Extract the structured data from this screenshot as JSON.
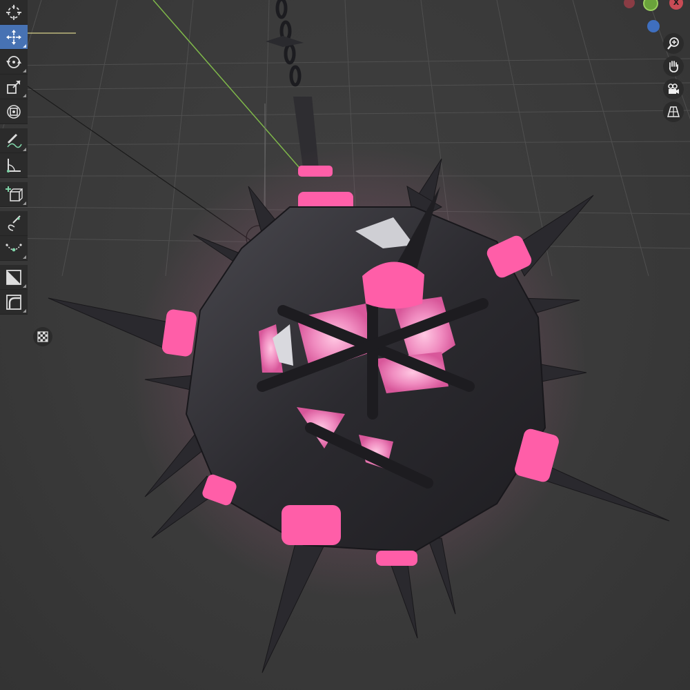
{
  "app": "3D viewport",
  "colors": {
    "viewport_bg": "#3a3a3a",
    "grid": "#555555",
    "toolbar_bg": "#2b2b2b",
    "active_tool": "#4772b3",
    "glow_pink": "#ff5ea8",
    "metal": "#2e2d31",
    "axis_y": "#7fb84a",
    "axis_x_gizmo": "#c84b55",
    "axis_z_gizmo": "#3f6fbf"
  },
  "toolbar": {
    "tools": [
      {
        "id": "cursor",
        "icon": "cursor-icon",
        "active": false
      },
      {
        "id": "move",
        "icon": "move-icon",
        "active": true
      },
      {
        "id": "rotate",
        "icon": "rotate-icon",
        "active": false
      },
      {
        "id": "scale",
        "icon": "scale-icon",
        "active": false
      },
      {
        "id": "transform",
        "icon": "transform-icon",
        "active": false
      },
      {
        "id": "annotate",
        "icon": "annotate-icon",
        "active": false
      },
      {
        "id": "measure",
        "icon": "measure-icon",
        "active": false
      },
      {
        "id": "add-cube",
        "icon": "add-cube-icon",
        "active": false
      },
      {
        "id": "curve-draw",
        "icon": "curve-draw-icon",
        "active": false
      },
      {
        "id": "curve-pen",
        "icon": "curve-pen-icon",
        "active": false
      },
      {
        "id": "extrude",
        "icon": "extrude-icon",
        "active": false
      },
      {
        "id": "bevel",
        "icon": "bevel-icon",
        "active": false
      }
    ]
  },
  "navigation": {
    "buttons": [
      "zoom-icon",
      "hand-pan-icon",
      "camera-icon",
      "perspective-grid-icon"
    ]
  },
  "gizmo": {
    "axes": [
      "x",
      "y",
      "z"
    ],
    "x_label": "X"
  }
}
